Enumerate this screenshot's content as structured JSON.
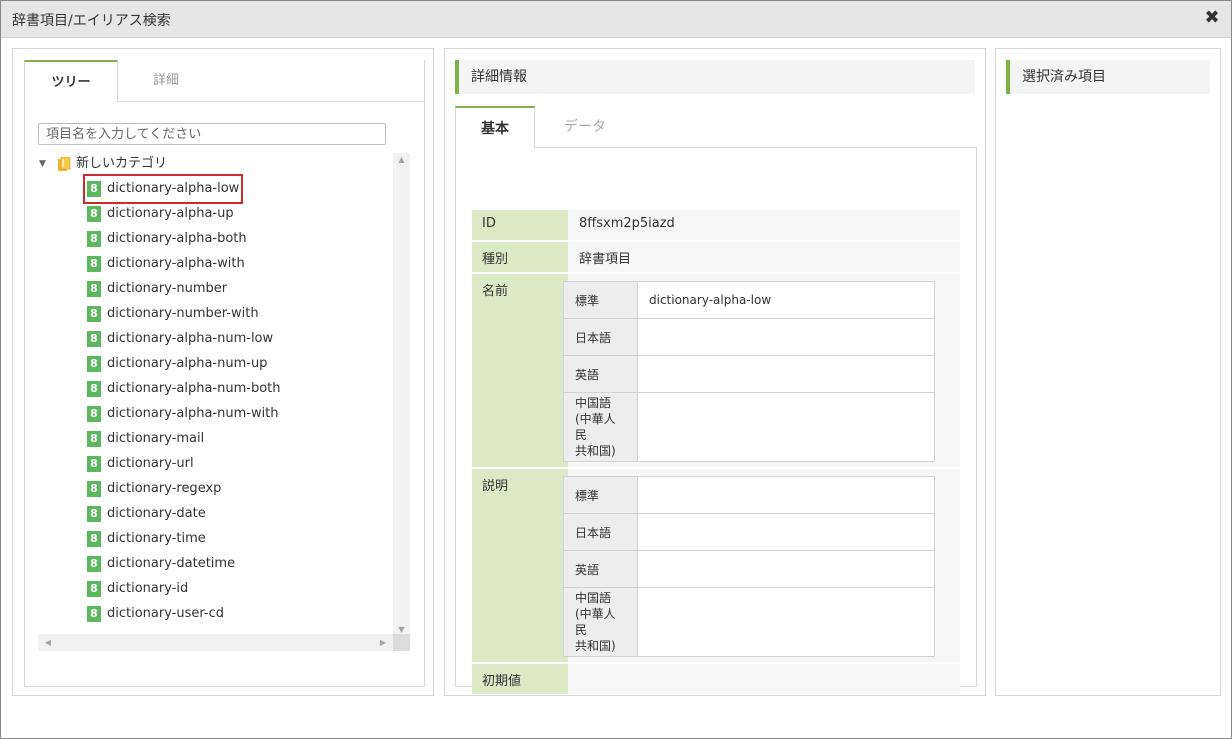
{
  "dialog": {
    "title": "辞書項目/エイリアス検索",
    "close_glyph": "✖"
  },
  "left": {
    "tabs": [
      "ツリー",
      "詳細"
    ],
    "search_placeholder": "項目名を入力してください",
    "category": "新しいカテゴリ",
    "leaf_icon_glyph": "8",
    "items": [
      "dictionary-alpha-low",
      "dictionary-alpha-up",
      "dictionary-alpha-both",
      "dictionary-alpha-with",
      "dictionary-number",
      "dictionary-number-with",
      "dictionary-alpha-num-low",
      "dictionary-alpha-num-up",
      "dictionary-alpha-num-both",
      "dictionary-alpha-num-with",
      "dictionary-mail",
      "dictionary-url",
      "dictionary-regexp",
      "dictionary-date",
      "dictionary-time",
      "dictionary-datetime",
      "dictionary-id",
      "dictionary-user-cd"
    ],
    "selected_index": 0
  },
  "middle": {
    "header": "詳細情報",
    "tabs": [
      "基本",
      "データ"
    ],
    "fields": {
      "id_label": "ID",
      "id_value": "8ffsxm2p5iazd",
      "type_label": "種別",
      "type_value": "辞書項目",
      "name_label": "名前",
      "desc_label": "説明",
      "default_label": "初期値",
      "default_value": ""
    },
    "name_rows": [
      {
        "lang": "標準",
        "value": "dictionary-alpha-low"
      },
      {
        "lang": "日本語",
        "value": ""
      },
      {
        "lang": "英語",
        "value": ""
      },
      {
        "lang": "中国語\n(中華人民\n共和国)",
        "value": ""
      }
    ],
    "desc_rows": [
      {
        "lang": "標準",
        "value": ""
      },
      {
        "lang": "日本語",
        "value": ""
      },
      {
        "lang": "英語",
        "value": ""
      },
      {
        "lang": "中国語\n(中華人民\n共和国)",
        "value": ""
      }
    ]
  },
  "right": {
    "header": "選択済み項目"
  },
  "colors": {
    "accent": "#7fb348",
    "leaf_icon": "#5cb85c",
    "selection_outline": "#cc2b2b",
    "key_bg": "#dce9c7"
  }
}
